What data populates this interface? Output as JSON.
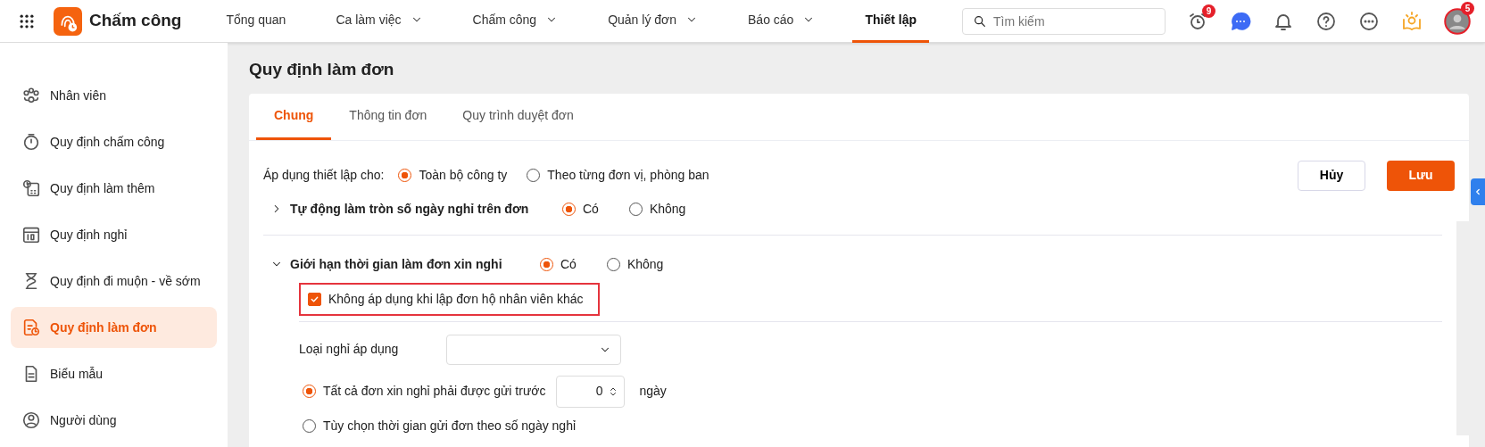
{
  "app": {
    "title": "Chấm công"
  },
  "nav": [
    {
      "label": "Tổng quan",
      "dropdown": false,
      "selected": false
    },
    {
      "label": "Ca làm việc",
      "dropdown": true,
      "selected": false
    },
    {
      "label": "Chấm công",
      "dropdown": true,
      "selected": false
    },
    {
      "label": "Quản lý đơn",
      "dropdown": true,
      "selected": false
    },
    {
      "label": "Báo cáo",
      "dropdown": true,
      "selected": false
    },
    {
      "label": "Thiết lập",
      "dropdown": false,
      "selected": true
    }
  ],
  "search": {
    "placeholder": "Tìm kiếm"
  },
  "header_badges": {
    "alarm": "9",
    "avatar": "5"
  },
  "sidebar": {
    "items": [
      {
        "label": "Nhân viên",
        "selected": false
      },
      {
        "label": "Quy định chấm công",
        "selected": false
      },
      {
        "label": "Quy định làm thêm",
        "selected": false
      },
      {
        "label": "Quy định nghỉ",
        "selected": false
      },
      {
        "label": "Quy định đi muộn - về sớm",
        "selected": false
      },
      {
        "label": "Quy định làm đơn",
        "selected": true
      },
      {
        "label": "Biểu mẫu",
        "selected": false
      },
      {
        "label": "Người dùng",
        "selected": false
      }
    ]
  },
  "page_title": "Quy định làm đơn",
  "tabs": [
    {
      "label": "Chung",
      "selected": true
    },
    {
      "label": "Thông tin đơn",
      "selected": false
    },
    {
      "label": "Quy trình duyệt đơn",
      "selected": false
    }
  ],
  "apply_to": {
    "label": "Áp dụng thiết lập cho:",
    "options": [
      {
        "label": "Toàn bộ công ty",
        "selected": true
      },
      {
        "label": "Theo từng đơn vị, phòng ban",
        "selected": false
      }
    ]
  },
  "buttons": {
    "cancel": "Hủy",
    "save": "Lưu"
  },
  "sections": [
    {
      "title": "Tự động làm tròn số ngày nghỉ trên đơn",
      "expanded": false,
      "options": [
        {
          "label": "Có",
          "selected": true
        },
        {
          "label": "Không",
          "selected": false
        }
      ]
    },
    {
      "title": "Giới hạn thời gian làm đơn xin nghỉ",
      "expanded": true,
      "options": [
        {
          "label": "Có",
          "selected": true
        },
        {
          "label": "Không",
          "selected": false
        }
      ],
      "checkbox": {
        "label": "Không áp dụng khi lập đơn hộ nhân viên khác",
        "checked": true,
        "highlighted": true
      },
      "leave_type": {
        "label": "Loại nghỉ áp dụng"
      },
      "rules": [
        {
          "label": "Tất cả đơn xin nghỉ phải được gửi trước",
          "selected": true,
          "value": "0",
          "unit": "ngày"
        },
        {
          "label": "Tùy chọn thời gian gửi đơn theo số ngày nghỉ",
          "selected": false
        }
      ]
    }
  ]
}
